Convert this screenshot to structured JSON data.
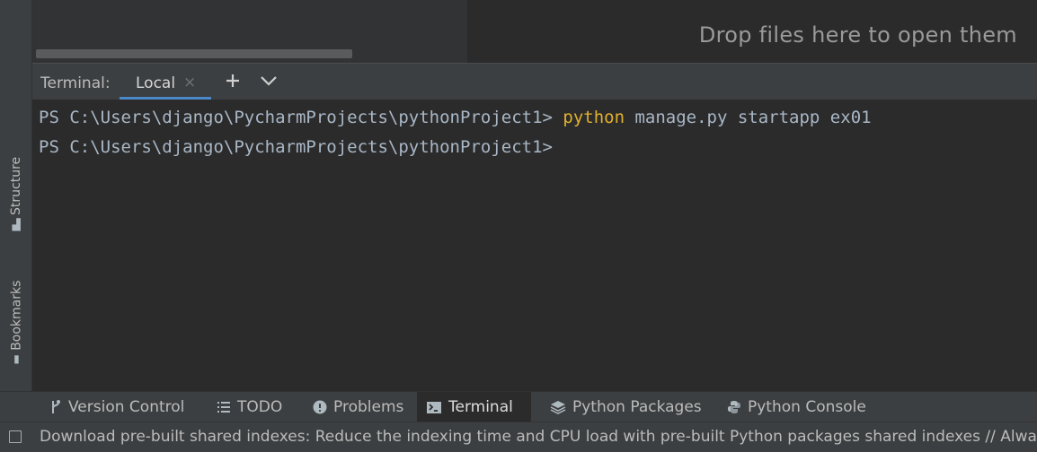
{
  "left_strip": {
    "structure_label": "Structure",
    "bookmarks_label": "Bookmarks"
  },
  "editor": {
    "drop_hint": "Drop files here to open them"
  },
  "terminal": {
    "title": "Terminal:",
    "tab_label": "Local",
    "close_glyph": "×",
    "lines": [
      {
        "prompt": "PS C:\\Users\\django\\PycharmProjects\\pythonProject1> ",
        "keyword": "python",
        "rest": " manage.py startapp ex01"
      },
      {
        "prompt": "PS C:\\Users\\django\\PycharmProjects\\pythonProject1>",
        "keyword": "",
        "rest": ""
      }
    ]
  },
  "tool_windows": [
    {
      "label": "Version Control",
      "icon": "branch-icon"
    },
    {
      "label": "TODO",
      "icon": "list-icon"
    },
    {
      "label": "Problems",
      "icon": "info-icon"
    },
    {
      "label": "Terminal",
      "icon": "terminal-icon",
      "active": true
    },
    {
      "label": "Python Packages",
      "icon": "layers-icon"
    },
    {
      "label": "Python Console",
      "icon": "python-icon"
    }
  ],
  "status_bar": {
    "message": "Download pre-built shared indexes: Reduce the indexing time and CPU load with pre-built Python packages shared indexes // Always"
  },
  "colors": {
    "background": "#2b2b2b",
    "panel": "#3c3f41",
    "accent": "#4a88c7",
    "keyword": "#e0b12e",
    "terminal_text": "#a9b7c6"
  }
}
